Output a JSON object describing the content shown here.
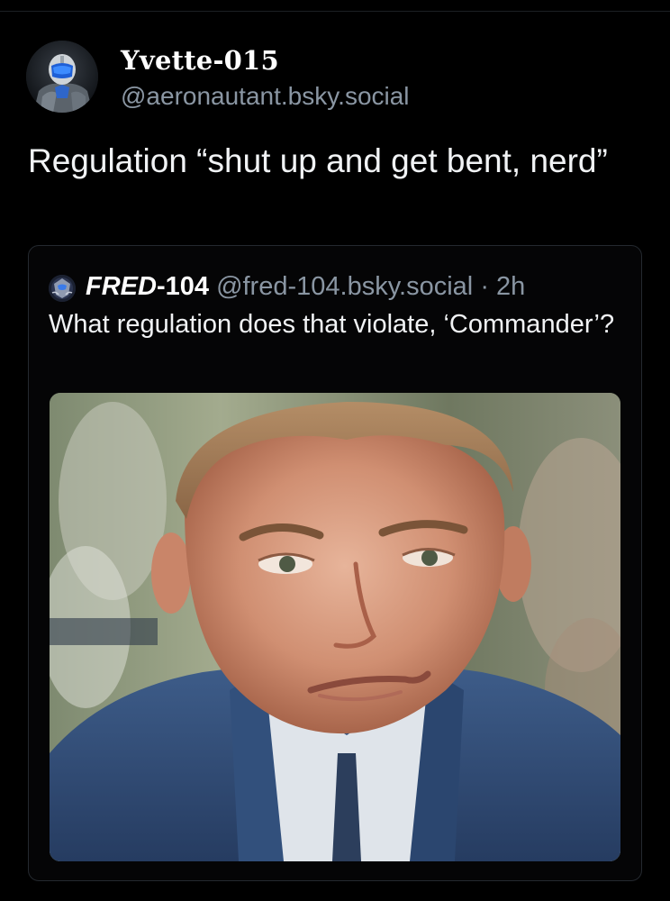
{
  "post": {
    "author": {
      "display_name": "Yvette-015",
      "handle": "@aeronautant.bsky.social",
      "avatar": "armored-soldier-avatar"
    },
    "text": "Regulation “shut up and get bent, nerd”",
    "quote": {
      "author": {
        "display_name_italic": "FRED",
        "display_name_rest": "-104",
        "handle": "@fred-104.bsky.social",
        "separator": "·",
        "time": "2h",
        "avatar": "soldier-emblem-avatar"
      },
      "text": "What regulation does that violate, ‘Commander’?",
      "image": "smirking-man-in-suit-photo"
    }
  },
  "colors": {
    "background": "#000000",
    "primary_text": "#f1f3f5",
    "secondary_text": "#8a96a3",
    "card_border": "#24292f"
  }
}
